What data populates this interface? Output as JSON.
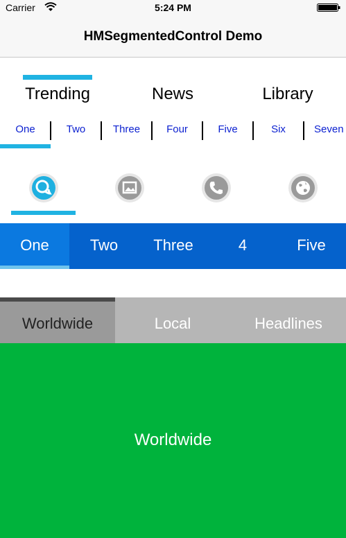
{
  "status_bar": {
    "carrier": "Carrier",
    "time": "5:24 PM"
  },
  "nav": {
    "title": "HMSegmentedControl Demo"
  },
  "seg1": {
    "items": [
      "Trending",
      "News",
      "Library"
    ],
    "selected": 0
  },
  "seg2": {
    "items": [
      "One",
      "Two",
      "Three",
      "Four",
      "Five",
      "Six",
      "Seven"
    ],
    "selected": 0
  },
  "seg3": {
    "icons": [
      "chat-icon",
      "image-icon",
      "phone-icon",
      "globe-icon"
    ],
    "selected": 0
  },
  "seg4": {
    "items": [
      "One",
      "Two",
      "Three",
      "4",
      "Five"
    ],
    "selected": 0
  },
  "seg5": {
    "items": [
      "Worldwide",
      "Local",
      "Headlines"
    ],
    "selected": 0
  },
  "content": {
    "label": "Worldwide"
  },
  "colors": {
    "indicator": "#20b3e2",
    "seg4_bg": "#0562cc",
    "content_bg": "#00b33c"
  }
}
